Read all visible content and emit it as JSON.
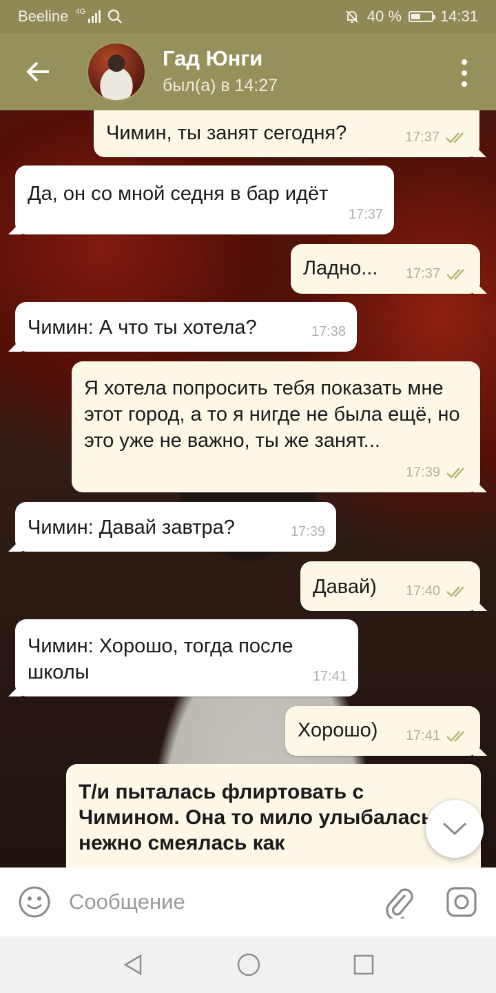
{
  "status_bar": {
    "carrier": "Beeline",
    "network": "4G",
    "battery_percent": "40 %",
    "battery_level": 0.4,
    "time": "14:31"
  },
  "header": {
    "contact_name": "Гад Юнги",
    "last_seen": "был(а) в 14:27"
  },
  "messages": [
    {
      "direction": "out",
      "text": "Чимин, ты занят сегодня?",
      "time": "17:37",
      "read": true
    },
    {
      "direction": "in",
      "text": "Да, он со мной седня в бар идёт",
      "time": "17:37"
    },
    {
      "direction": "out",
      "text": "Ладно...",
      "time": "17:37",
      "read": true
    },
    {
      "direction": "in",
      "text": "Чимин: А что ты хотела?",
      "time": "17:38"
    },
    {
      "direction": "out",
      "text": "Я хотела попросить тебя показать мне этот город, а то я нигде не была ещё, но это уже не важно, ты же занят...",
      "time": "17:39",
      "read": true
    },
    {
      "direction": "in",
      "text": "Чимин: Давай завтра?",
      "time": "17:39"
    },
    {
      "direction": "out",
      "text": "Давай)",
      "time": "17:40",
      "read": true
    },
    {
      "direction": "in",
      "text": "Чимин: Хорошо, тогда после школы",
      "time": "17:41"
    },
    {
      "direction": "out",
      "text": "Хорошо)",
      "time": "17:41",
      "read": true
    }
  ],
  "story_message": {
    "text": "Т/и пыталась флиртовать с Чимином. Она то мило улыбалась, то нежно смеялась как"
  },
  "composer": {
    "placeholder": "Сообщение"
  },
  "icons": {
    "back": "arrow-left-icon",
    "menu": "more-vertical-icon",
    "emoji": "smiley-icon",
    "attach": "paperclip-icon",
    "camera": "camera-icon",
    "scroll": "chevron-down-icon",
    "nav_back": "triangle-back-icon",
    "nav_home": "circle-home-icon",
    "nav_recents": "square-recents-icon"
  },
  "colors": {
    "header": "#96915a",
    "status_bar": "#8f8a55",
    "outgoing_bubble": "#fdf8e5",
    "incoming_bubble": "#ffffff",
    "read_ticks": "#b9b27a"
  }
}
